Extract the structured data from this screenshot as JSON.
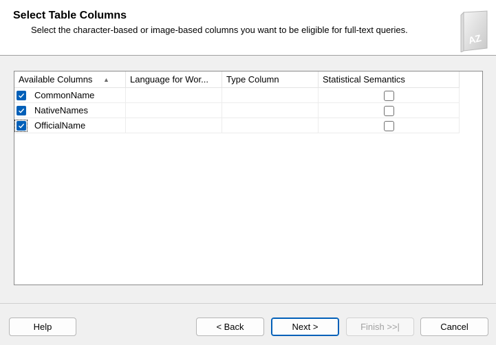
{
  "header": {
    "title": "Select Table Columns",
    "subtitle": "Select the character-based or image-based columns you want to be eligible for full-text queries.",
    "icon": "book-az-icon",
    "icon_text": "AZ"
  },
  "grid": {
    "columns": [
      "Available Columns",
      "Language for Wor...",
      "Type Column",
      "Statistical Semantics"
    ],
    "sort_column": "Available Columns",
    "sort_direction": "ascending",
    "rows": [
      {
        "checked": true,
        "name": "CommonName",
        "language": "",
        "type_column": "",
        "statistical_semantics": false
      },
      {
        "checked": true,
        "name": "NativeNames",
        "language": "",
        "type_column": "",
        "statistical_semantics": false
      },
      {
        "checked": true,
        "name": "OfficialName",
        "language": "",
        "type_column": "",
        "statistical_semantics": false
      }
    ]
  },
  "buttons": {
    "help": "Help",
    "back": "< Back",
    "next": "Next >",
    "finish": "Finish >>|",
    "cancel": "Cancel"
  },
  "colors": {
    "accent": "#005fb8",
    "checkbox_checked": "#005fb8",
    "disabled_text": "#a0a0a0",
    "background": "#f0f0f0"
  }
}
